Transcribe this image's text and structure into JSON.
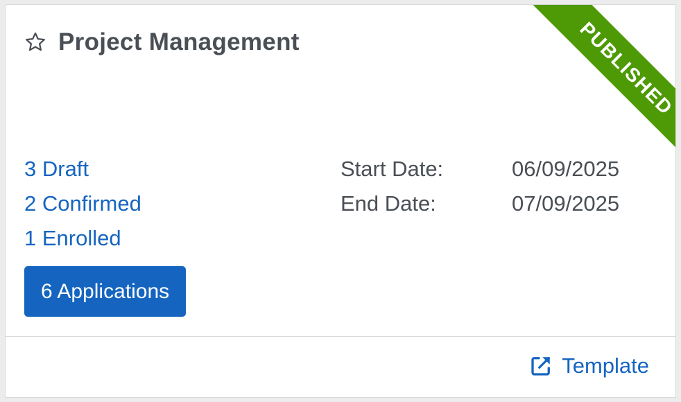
{
  "card": {
    "title": "Project Management",
    "ribbon": "PUBLISHED",
    "ribbon_color": "#4e9a06",
    "accent_color": "#1565c0",
    "statuses": [
      {
        "label": "3 Draft"
      },
      {
        "label": "2 Confirmed"
      },
      {
        "label": "1 Enrolled"
      }
    ],
    "dates": {
      "start_label": "Start Date:",
      "start_value": "06/09/2025",
      "end_label": "End Date:",
      "end_value": "07/09/2025"
    },
    "applications_button": "6 Applications",
    "footer_link": "Template",
    "icons": {
      "favorite": "star-outline-icon",
      "footer": "external-link-icon"
    }
  }
}
